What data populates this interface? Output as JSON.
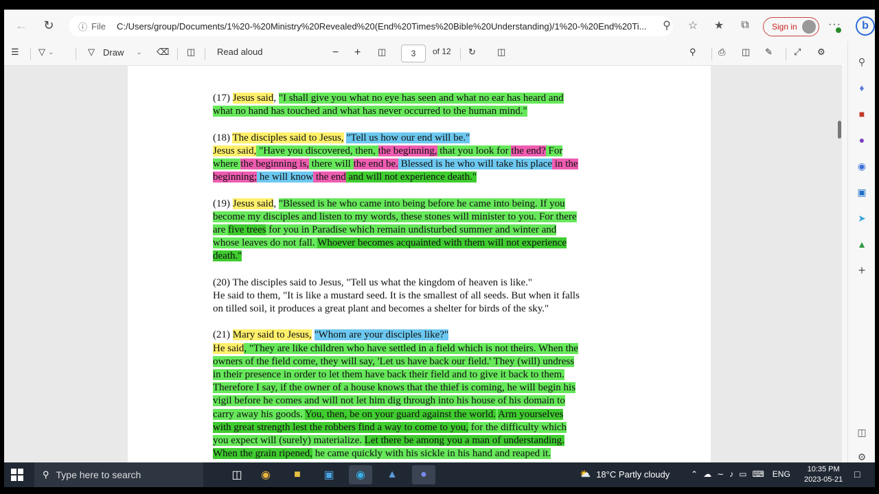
{
  "browser": {
    "url_prefix": "File",
    "url": "C:/Users/group/Documents/1%20-%20Ministry%20Revealed%20(End%20Times%20Bible%20Understanding)/1%20-%20End%20Ti...",
    "signin_label": "Sign in"
  },
  "pdf_toolbar": {
    "draw_label": "Draw",
    "read_aloud_label": "Read aloud",
    "page_current": "3",
    "page_total": "of 12"
  },
  "document": {
    "paragraphs": [
      {
        "id": "p17",
        "lines": [
          [
            [
              "(17) ",
              ""
            ],
            [
              "Jesus said",
              "y"
            ],
            [
              ", ",
              ""
            ],
            [
              "\"I shall give you what no eye has seen and what no ear has heard and",
              "g"
            ]
          ],
          [
            [
              "what no hand has touched and what has never occurred to the human mind.\"",
              "g"
            ]
          ]
        ]
      },
      {
        "id": "p18",
        "lines": [
          [
            [
              "(18) ",
              ""
            ],
            [
              "The disciples said to Jesus,",
              "y"
            ],
            [
              " ",
              ""
            ],
            [
              "\"Tell us how our end will be.\"",
              "b"
            ]
          ],
          [
            [
              "Jesus said,",
              "y"
            ],
            [
              " \"Have you discovered, then, ",
              "g"
            ],
            [
              "the beginning,",
              "p"
            ],
            [
              " that you look for ",
              "g"
            ],
            [
              "the end?",
              "p"
            ],
            [
              " For",
              "g"
            ]
          ],
          [
            [
              "where ",
              "g"
            ],
            [
              "the beginning is,",
              "p"
            ],
            [
              " there will ",
              "g"
            ],
            [
              "the end be.",
              "p"
            ],
            [
              " Blessed is he who will take his place",
              "b"
            ],
            [
              " in the",
              "p"
            ]
          ],
          [
            [
              "beginning;",
              "p"
            ],
            [
              " he will know",
              "b"
            ],
            [
              " the end",
              "p"
            ],
            [
              " and will not experience death.\"",
              "dg"
            ]
          ]
        ]
      },
      {
        "id": "p19",
        "lines": [
          [
            [
              "(19) ",
              ""
            ],
            [
              "Jesus said",
              "y"
            ],
            [
              ", ",
              ""
            ],
            [
              "\"Blessed is he who came into being before he came into being. If you",
              "g"
            ]
          ],
          [
            [
              "become my disciples and listen to my words, these stones will minister to you. For there",
              "g"
            ]
          ],
          [
            [
              "are ",
              "g"
            ],
            [
              "five trees",
              "dg"
            ],
            [
              " for you in Paradise which remain undisturbed summer and winter and",
              "g"
            ]
          ],
          [
            [
              "whose leaves do not fall. ",
              "g"
            ],
            [
              "Whoever becomes acquainted with them will not experience",
              "dg"
            ]
          ],
          [
            [
              "death.\"",
              "dg"
            ]
          ]
        ]
      },
      {
        "id": "p20",
        "lines": [
          [
            [
              "(20) The disciples said to Jesus, \"Tell us what the kingdom of heaven is like.\"",
              ""
            ]
          ],
          [
            [
              "He said to them, \"It is like a mustard seed. It is the smallest of all seeds. But when it falls",
              ""
            ]
          ],
          [
            [
              "on tilled soil, it produces a great plant and becomes a shelter for birds of the sky.\"",
              ""
            ]
          ]
        ]
      },
      {
        "id": "p21",
        "lines": [
          [
            [
              "(21) ",
              ""
            ],
            [
              "Mary said to Jesus,",
              "y"
            ],
            [
              " ",
              ""
            ],
            [
              "\"Whom are your disciples like?\"",
              "b"
            ]
          ],
          [
            [
              "He said",
              "y"
            ],
            [
              ", \"They are like children who have settled in a field which is not theirs. When the",
              "g"
            ]
          ],
          [
            [
              "owners of the field come, they will say, 'Let us have back our field.' They (will) undress",
              "g"
            ]
          ],
          [
            [
              "in their presence in order to let them have back their field and to give it back to them.",
              "g"
            ]
          ],
          [
            [
              "Therefore I say, if the owner of a house knows that the thief is coming, he will begin his",
              "g"
            ]
          ],
          [
            [
              "vigil before he comes and will not let him dig through into his house of his domain to",
              "g"
            ]
          ],
          [
            [
              "carry away his goods. ",
              "g"
            ],
            [
              "You, then, be on your guard against the world.",
              "dg"
            ],
            [
              " ",
              "g"
            ],
            [
              "Arm yourselves",
              "dg"
            ]
          ],
          [
            [
              "with great strength lest the robbers find a way to come to you,",
              "dg"
            ],
            [
              " for the difficulty which",
              "g"
            ]
          ],
          [
            [
              "you expect will (surely) materialize. ",
              "g"
            ],
            [
              "Let there be among you a man of understanding.",
              "dg"
            ]
          ],
          [
            [
              "When the grain ripened,",
              "dg"
            ],
            [
              " he came quickly with his sickle in his hand and reaped it.",
              "g"
            ]
          ]
        ]
      }
    ]
  },
  "taskbar": {
    "search_placeholder": "Type here to search",
    "weather": "18°C  Partly cloudy",
    "language": "ENG",
    "time": "10:35 PM",
    "date": "2023-05-21"
  }
}
